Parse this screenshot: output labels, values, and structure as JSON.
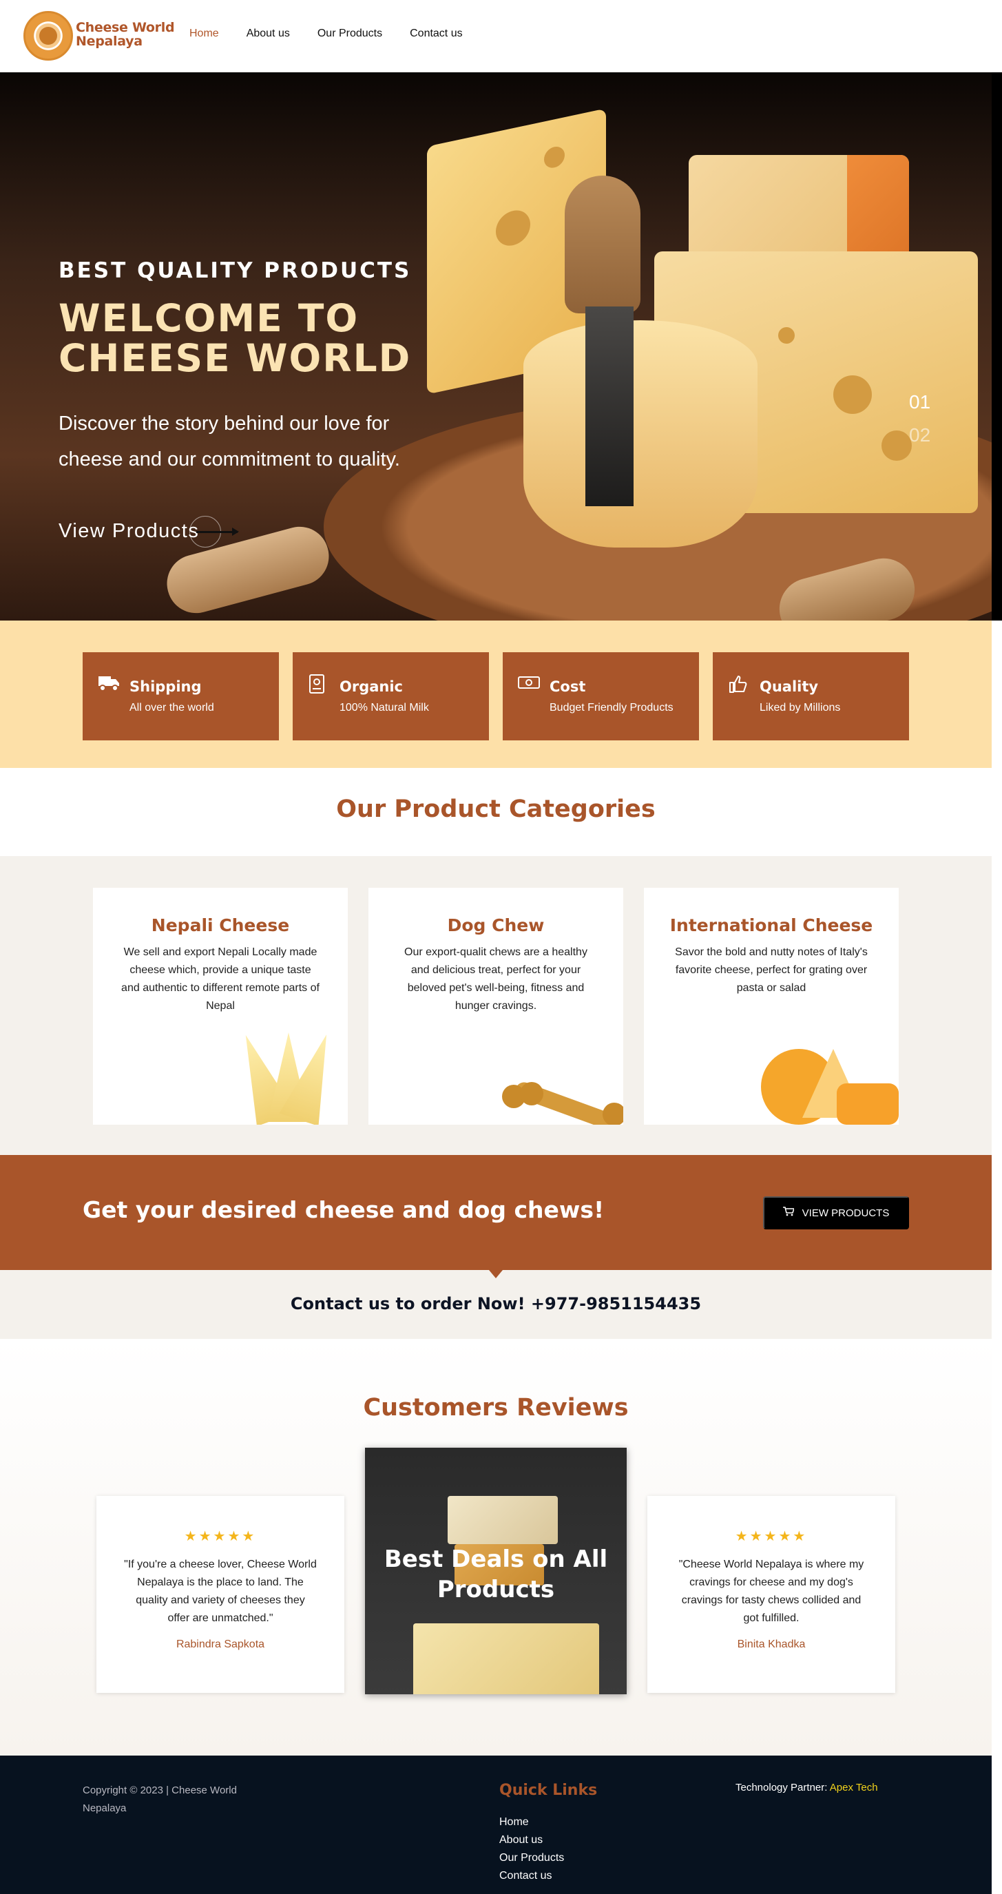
{
  "brand": {
    "name_line1": "Cheese World",
    "name_line2": "Nepalaya"
  },
  "nav": [
    {
      "label": "Home"
    },
    {
      "label": "About us"
    },
    {
      "label": "Our Products"
    },
    {
      "label": "Contact us"
    }
  ],
  "hero": {
    "eyebrow": "BEST QUALITY PRODUCTS",
    "headline_line1": "WELCOME TO",
    "headline_line2": "CHEESE WORLD",
    "lead": "Discover the story behind our love for cheese and our commitment to quality.",
    "cta": "View Products",
    "slides": [
      "01",
      "02"
    ]
  },
  "features": [
    {
      "icon": "truck-icon",
      "title": "Shipping",
      "subtitle": "All over the world"
    },
    {
      "icon": "certificate-icon",
      "title": "Organic",
      "subtitle": "100% Natural Milk"
    },
    {
      "icon": "money-icon",
      "title": "Cost",
      "subtitle": "Budget Friendly Products"
    },
    {
      "icon": "thumbs-up-icon",
      "title": "Quality",
      "subtitle": "Liked by Millions"
    }
  ],
  "categories": {
    "title": "Our Product Categories",
    "items": [
      {
        "name": "Nepali Cheese",
        "desc": "We sell and export Nepali Locally made cheese which, provide a unique taste and authentic to different remote parts of Nepal"
      },
      {
        "name": "Dog Chew",
        "desc": "Our export-qualit chews are a healthy and delicious treat, perfect for your beloved pet's well-being, fitness and hunger cravings."
      },
      {
        "name": "International Cheese",
        "desc": "Savor the bold and nutty notes of Italy's favorite cheese, perfect for grating over pasta or salad"
      }
    ]
  },
  "band": {
    "heading": "Get your desired cheese and dog chews!",
    "button": "VIEW PRODUCTS"
  },
  "contact": {
    "text": "Contact us to order Now! +977-9851154435"
  },
  "reviews": {
    "title": "Customers Reviews",
    "left": {
      "stars": "★★★★★",
      "quote": "\"If you're a cheese lover, Cheese World Nepalaya is the place to land. The quality and variety of cheeses they offer are unmatched.\"",
      "author": "Rabindra Sapkota"
    },
    "deal": {
      "line1": "Best Deals on All",
      "line2": "Products"
    },
    "right": {
      "stars": "★★★★★",
      "quote": "\"Cheese World Nepalaya is where my cravings for cheese and my dog's cravings for tasty chews collided and got fulfilled.",
      "author": "Binita Khadka"
    }
  },
  "footer": {
    "copyright": "Copyright © 2023 | Cheese World Nepalaya",
    "quick_links_title": "Quick Links",
    "quick_links": [
      "Home",
      "About us",
      "Our Products",
      "Contact us"
    ],
    "tech_label": "Technology Partner:",
    "tech_partner": "Apex Tech"
  },
  "colors": {
    "brand": "#a9552a",
    "feature_bg": "#fde0a8",
    "footer_bg": "#07121f",
    "accent_yellow": "#f1d21c"
  }
}
